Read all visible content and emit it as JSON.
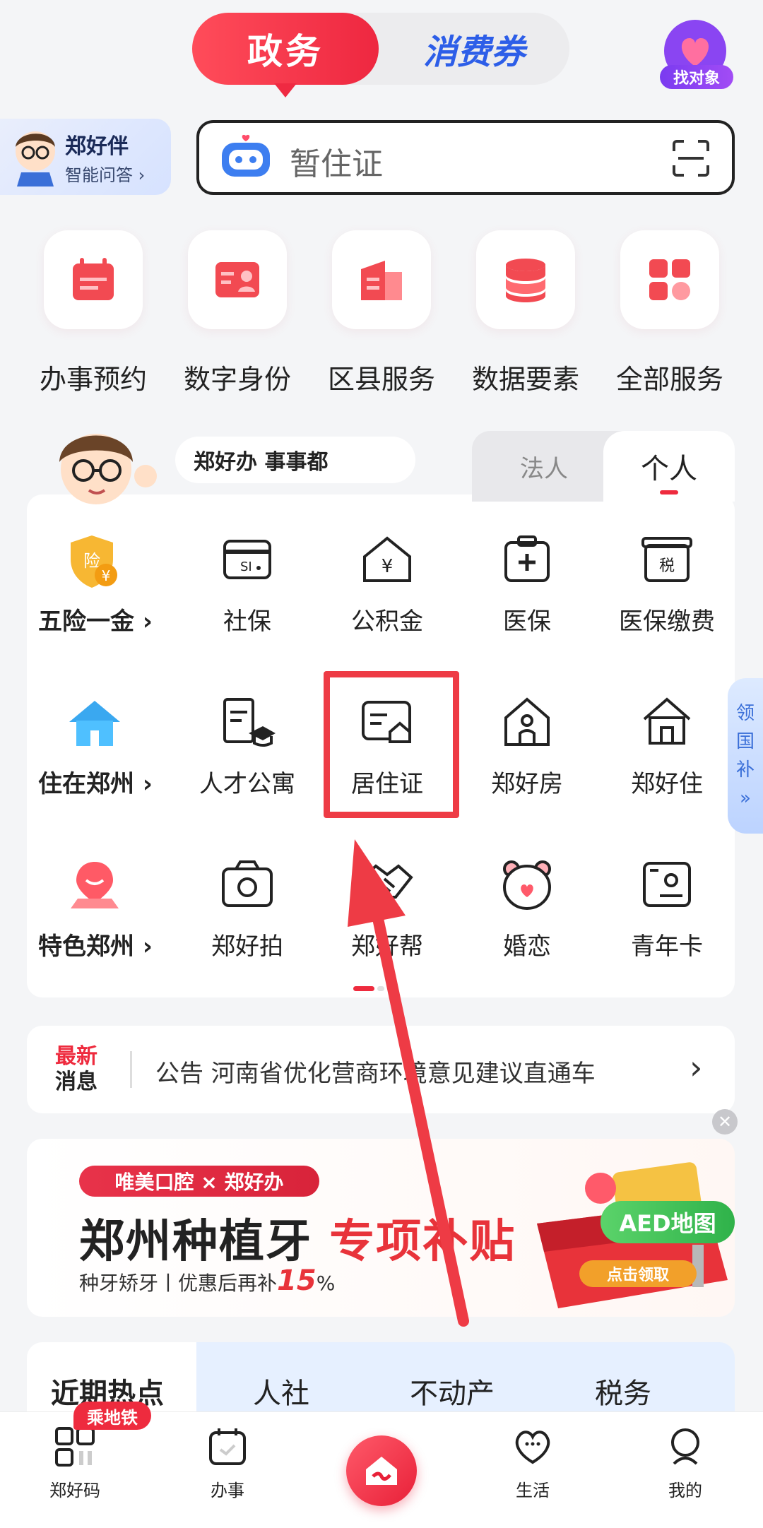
{
  "top": {
    "tab_active": "政务",
    "tab_inactive": "消费券",
    "corner_label": "找对象"
  },
  "assistant": {
    "title": "郑好伴",
    "subtitle": "智能问答",
    "chevron": "›"
  },
  "search": {
    "placeholder": "暂住证"
  },
  "quick": [
    {
      "label": "办事预约",
      "icon": "calendar-icon"
    },
    {
      "label": "数字身份",
      "icon": "id-card-icon"
    },
    {
      "label": "区县服务",
      "icon": "building-icon"
    },
    {
      "label": "数据要素",
      "icon": "database-icon"
    },
    {
      "label": "全部服务",
      "icon": "grid-icon"
    }
  ],
  "panel": {
    "slogan": "郑好办  事事都",
    "tab_legal": "法人",
    "tab_personal": "个人",
    "rows": [
      {
        "label": "五险一金 ›",
        "items": [
          "社保",
          "公积金",
          "医保",
          "医保缴费"
        ]
      },
      {
        "label": "住在郑州 ›",
        "items": [
          "人才公寓",
          "居住证",
          "郑好房",
          "郑好住"
        ]
      },
      {
        "label": "特色郑州 ›",
        "items": [
          "郑好拍",
          "郑好帮",
          "婚恋",
          "青年卡"
        ]
      }
    ],
    "side_tab": [
      "领",
      "国",
      "补",
      "»"
    ]
  },
  "news": {
    "tag_line1": "最新",
    "tag_line2": "消息",
    "text": "公告  河南省优化营商环境意见建议直通车",
    "chevron": "›"
  },
  "banner": {
    "tag": "唯美口腔 × 郑好办",
    "title_main": "郑州种植牙 ",
    "title_accent": "专项补贴",
    "subtitle_pre": "种牙矫牙丨优惠后再补",
    "subtitle_num": "15",
    "subtitle_suffix": "%",
    "overlay": "AED地图",
    "cta": "点击领取",
    "close": "✕"
  },
  "hot": {
    "tabs": [
      "近期热点",
      "人社",
      "不动产",
      "税务"
    ]
  },
  "nav": {
    "items": [
      "郑好码",
      "办事",
      "生活",
      "我的"
    ],
    "metro_badge": "乘地铁"
  },
  "colors": {
    "brand_red": "#ee2b3e",
    "accent_blue": "#2d5ee8",
    "highlight": "#ee3b45"
  }
}
